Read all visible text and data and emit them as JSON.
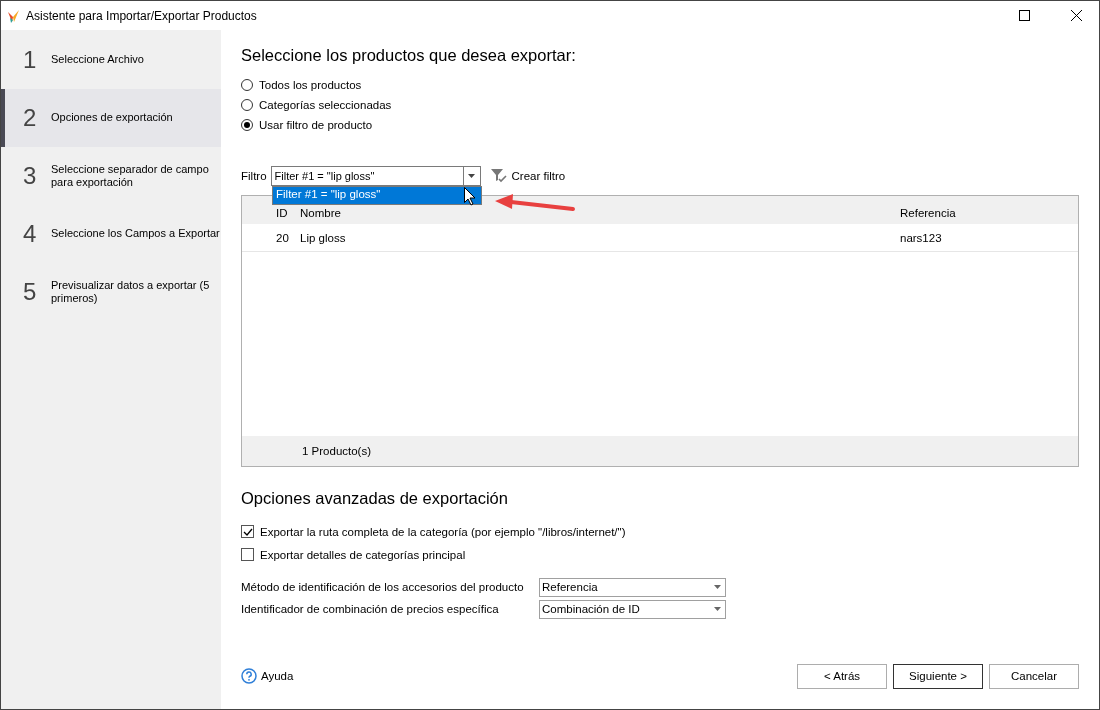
{
  "window": {
    "title": "Asistente para Importar/Exportar Productos"
  },
  "steps": [
    {
      "number": "1",
      "label": "Seleccione Archivo",
      "selected": false
    },
    {
      "number": "2",
      "label": "Opciones de exportación",
      "selected": true
    },
    {
      "number": "3",
      "label": "Seleccione separador de campo para exportación",
      "selected": false
    },
    {
      "number": "4",
      "label": "Seleccione los Campos a Exportar",
      "selected": false
    },
    {
      "number": "5",
      "label": "Previsualizar datos a exportar (5 primeros)",
      "selected": false
    }
  ],
  "products": {
    "heading": "Seleccione los productos que desea exportar:",
    "options": [
      {
        "label": "Todos los productos",
        "selected": false
      },
      {
        "label": "Categorías seleccionadas",
        "selected": false
      },
      {
        "label": "Usar filtro de producto",
        "selected": true
      }
    ]
  },
  "filter": {
    "label": "Filtro",
    "value": "Filter #1 = \"lip gloss\"",
    "expanded": true,
    "options": [
      {
        "label": "Filter #1 = \"lip gloss\"",
        "selected": true
      }
    ],
    "create_button": "Crear filtro"
  },
  "table": {
    "columns": [
      "ID",
      "Nombre",
      "Referencia"
    ],
    "rows": [
      [
        "20",
        "Lip gloss",
        "nars123"
      ]
    ],
    "footer": "1 Producto(s)"
  },
  "advanced": {
    "heading": "Opciones avanzadas de exportación",
    "checkboxes": [
      {
        "label": "Exportar la ruta completa de la categoría (por ejemplo \"/libros/internet/\")",
        "checked": true
      },
      {
        "label": "Exportar detalles de categorías principal",
        "checked": false
      }
    ],
    "selects": [
      {
        "label": "Método de identificación de los accesorios del producto",
        "value": "Referencia"
      },
      {
        "label": "Identificador de combinación de precios específica",
        "value": "Combinación de ID"
      }
    ]
  },
  "help": "Ayuda",
  "buttons": [
    {
      "label": "< Atrás",
      "default": false
    },
    {
      "label": "Siguiente >",
      "default": true
    },
    {
      "label": "Cancelar",
      "default": false
    }
  ]
}
